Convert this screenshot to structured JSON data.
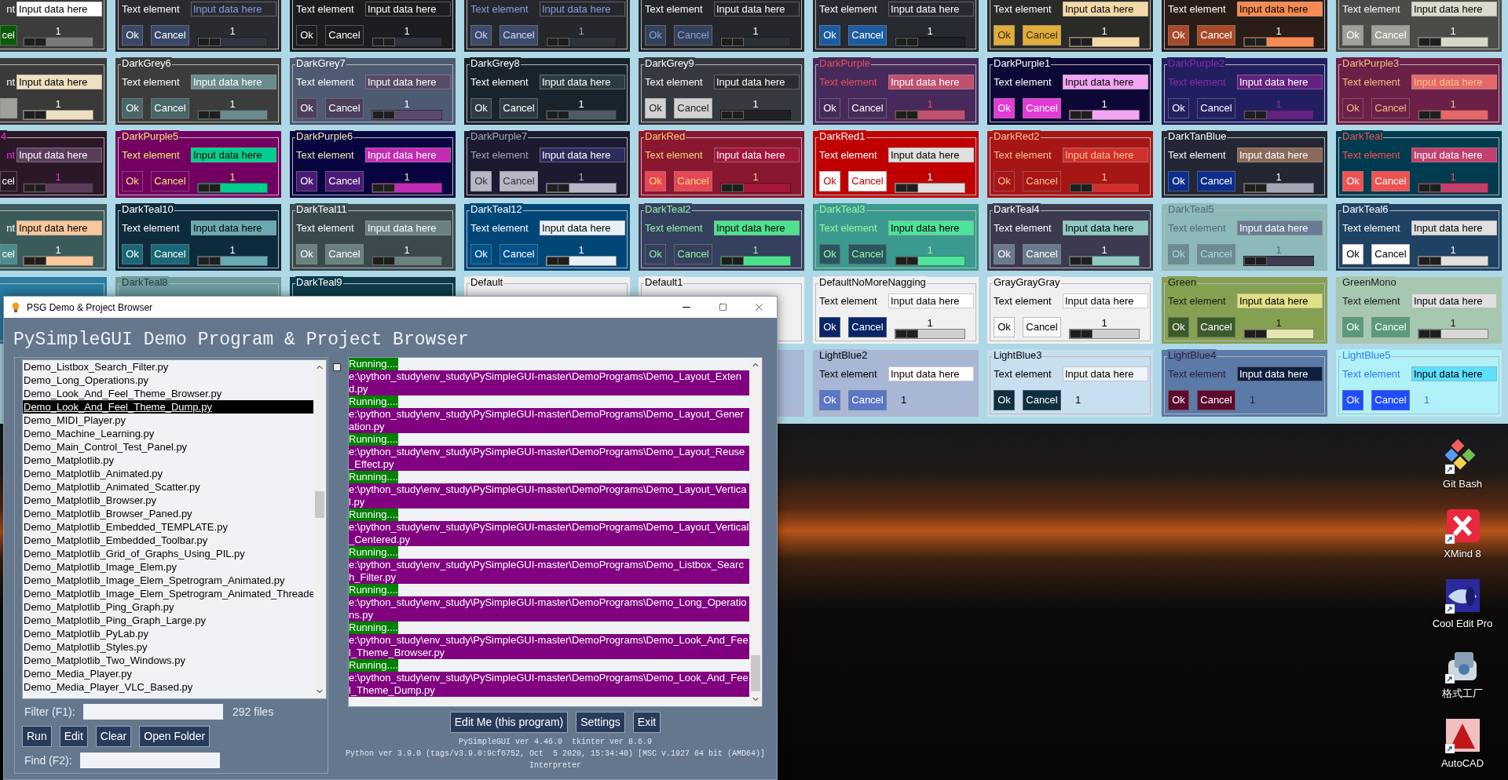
{
  "theme_rows": [
    [
      {
        "kind": "clipped",
        "label": "nt",
        "input": "Input data here",
        "cancel": "cel",
        "value": "1",
        "level": 0,
        "color": "#3c3c3c"
      },
      {
        "kind": "full",
        "label": "Text element",
        "input": "Input data here",
        "ok": "Ok",
        "cancel": "Cancel",
        "value": "1",
        "level": 0,
        "color": "#2a2b30"
      },
      {
        "kind": "full",
        "label": "Text element",
        "input": "Input data here",
        "ok": "Ok",
        "cancel": "Cancel",
        "value": "1",
        "level": 0,
        "color": "#1c1d21"
      },
      {
        "kind": "full",
        "label": "Text element",
        "input": "Input data here",
        "ok": "Ok",
        "cancel": "Cancel",
        "value": "1",
        "level": 0,
        "color": "#25272c"
      },
      {
        "kind": "full",
        "label": "Text element",
        "input": "Input data here",
        "ok": "Ok",
        "cancel": "Cancel",
        "value": "1",
        "level": 0,
        "color": "#24262b"
      },
      {
        "kind": "full",
        "label": "Text element",
        "input": "Input data here",
        "ok": "Ok",
        "cancel": "Cancel",
        "value": "1",
        "level": 0,
        "color": "#272a30"
      },
      {
        "kind": "full",
        "label": "Text element",
        "input": "Input data here",
        "ok": "Ok",
        "cancel": "Cancel",
        "value": "1",
        "level": 0,
        "color": "#2a2a27"
      },
      {
        "kind": "full",
        "label": "Text element",
        "input": "Input data here",
        "ok": "Ok",
        "cancel": "Cancel",
        "value": "1",
        "level": 0,
        "color": "#2a1c17"
      },
      {
        "kind": "full",
        "label": "Text element",
        "input": "Input data here",
        "ok": "Ok",
        "cancel": "Cancel",
        "value": "1",
        "level": 0,
        "color": "#4b4b47"
      }
    ],
    [
      {
        "kind": "clipped",
        "label": "nt",
        "input": "Input data here",
        "value": "1",
        "level": 0,
        "color": "#3a3a3a"
      },
      {
        "kind": "full",
        "title": "DarkGrey6",
        "label": "Text element",
        "input": "Input data here",
        "ok": "Ok",
        "cancel": "Cancel",
        "value": "1",
        "level": 0,
        "color": "#3c3c3c"
      },
      {
        "kind": "full",
        "title": "DarkGrey7",
        "label": "Text element",
        "input": "Input data here",
        "ok": "Ok",
        "cancel": "Cancel",
        "value": "1",
        "level": 0,
        "color": "#4d5a72"
      },
      {
        "kind": "full",
        "title": "DarkGrey8",
        "label": "Text element",
        "input": "Input data here",
        "ok": "Ok",
        "cancel": "Cancel",
        "value": "1",
        "level": 0,
        "color": "#18232c"
      },
      {
        "kind": "full",
        "title": "DarkGrey9",
        "label": "Text element",
        "input": "Input data here",
        "ok": "Ok",
        "cancel": "Cancel",
        "value": "1",
        "level": 0,
        "color": "#36393f"
      },
      {
        "kind": "full",
        "title": "DarkPurple",
        "label": "Text element",
        "input": "Input data here",
        "ok": "Ok",
        "cancel": "Cancel",
        "value": "1",
        "level": 0,
        "color": "#472a5c"
      },
      {
        "kind": "full",
        "title": "DarkPurple1",
        "label": "Text element",
        "input": "Input data here",
        "ok": "Ok",
        "cancel": "Cancel",
        "value": "1",
        "level": 0,
        "color": "#0c0735"
      },
      {
        "kind": "full",
        "title": "DarkPurple2",
        "label": "Text element",
        "input": "Input data here",
        "ok": "Ok",
        "cancel": "Cancel",
        "value": "1",
        "level": 0,
        "color": "#211f62"
      },
      {
        "kind": "full",
        "title": "DarkPurple3",
        "label": "Text element",
        "input": "Input data here",
        "ok": "Ok",
        "cancel": "Cancel",
        "value": "1",
        "level": 0,
        "color": "#6c1f47"
      }
    ],
    [
      {
        "kind": "clipped",
        "title": "4",
        "label": "nt",
        "input": "Input data here",
        "cancel": "cel",
        "value": "1",
        "level": 0,
        "color": "#2a1727"
      },
      {
        "kind": "full",
        "title": "DarkPurple5",
        "label": "Text element",
        "input": "Input data here",
        "ok": "Ok",
        "cancel": "Cancel",
        "value": "1",
        "level": 0,
        "color": "#730061"
      },
      {
        "kind": "full",
        "title": "DarkPurple6",
        "label": "Text element",
        "input": "Input data here",
        "ok": "Ok",
        "cancel": "Cancel",
        "value": "1",
        "level": 0,
        "color": "#080440"
      },
      {
        "kind": "full",
        "title": "DarkPurple7",
        "label": "Text element",
        "input": "Input data here",
        "ok": "Ok",
        "cancel": "Cancel",
        "value": "1",
        "level": 0,
        "color": "#1b1a30"
      },
      {
        "kind": "full",
        "title": "DarkRed",
        "label": "Text element",
        "input": "Input data here",
        "ok": "Ok",
        "cancel": "Cancel",
        "value": "1",
        "level": 0,
        "color": "#8a1730"
      },
      {
        "kind": "full",
        "title": "DarkRed1",
        "label": "Text element",
        "input": "Input data here",
        "ok": "Ok",
        "cancel": "Cancel",
        "value": "1",
        "level": 0,
        "color": "#c00000"
      },
      {
        "kind": "full",
        "title": "DarkRed2",
        "label": "Text element",
        "input": "Input data here",
        "ok": "Ok",
        "cancel": "Cancel",
        "value": "1",
        "level": 0,
        "color": "#a81515"
      },
      {
        "kind": "full",
        "title": "DarkTanBlue",
        "label": "Text element",
        "input": "Input data here",
        "ok": "Ok",
        "cancel": "Cancel",
        "value": "1",
        "level": 0,
        "color": "#232734"
      },
      {
        "kind": "full",
        "title": "DarkTeal",
        "label": "Text element",
        "input": "Input data here",
        "ok": "Ok",
        "cancel": "Cancel",
        "value": "1",
        "level": 0,
        "color": "#003b50"
      }
    ],
    [
      {
        "kind": "clipped",
        "label": "nt",
        "input": "Input data here",
        "cancel": "cel",
        "value": "1",
        "level": 0,
        "color": "#3b5b5b"
      },
      {
        "kind": "full",
        "title": "DarkTeal10",
        "label": "Text element",
        "input": "Input data here",
        "ok": "Ok",
        "cancel": "Cancel",
        "value": "1",
        "level": 0,
        "color": "#0d2b3b"
      },
      {
        "kind": "full",
        "title": "DarkTeal11",
        "label": "Text element",
        "input": "Input data here",
        "ok": "Ok",
        "cancel": "Cancel",
        "value": "1",
        "level": 0,
        "color": "#3a4a4c"
      },
      {
        "kind": "full",
        "title": "DarkTeal12",
        "label": "Text element",
        "input": "Input data here",
        "ok": "Ok",
        "cancel": "Cancel",
        "value": "1",
        "level": 0,
        "color": "#004778"
      },
      {
        "kind": "full",
        "title": "DarkTeal2",
        "label": "Text element",
        "input": "Input data here",
        "ok": "Ok",
        "cancel": "Cancel",
        "value": "1",
        "level": 0,
        "color": "#353f5e"
      },
      {
        "kind": "full",
        "title": "DarkTeal3",
        "label": "Text element",
        "input": "Input data here",
        "ok": "Ok",
        "cancel": "Cancel",
        "value": "1",
        "level": 0,
        "color": "#3b9a8f"
      },
      {
        "kind": "full",
        "title": "DarkTeal4",
        "label": "Text element",
        "input": "Input data here",
        "ok": "Ok",
        "cancel": "Cancel",
        "value": "1",
        "level": 0,
        "color": "#3b3a4e"
      },
      {
        "kind": "full",
        "title": "DarkTeal5",
        "label": "Text element",
        "input": "Input data here",
        "ok": "Ok",
        "cancel": "Cancel",
        "value": "1",
        "level": 0,
        "color": "#8cbab9"
      },
      {
        "kind": "full",
        "title": "DarkTeal6",
        "label": "Text element",
        "input": "Input data here",
        "ok": "Ok",
        "cancel": "Cancel",
        "value": "1",
        "level": 0,
        "color": "#1f4263"
      }
    ],
    [
      {
        "kind": "edge",
        "color": "#2a7ca2"
      },
      {
        "kind": "covered",
        "title": "DarkTeal8",
        "color": "#6e9c9e"
      },
      {
        "kind": "covered",
        "title": "DarkTeal9",
        "color": "#0d3a4a"
      },
      {
        "kind": "covered",
        "title": "Default",
        "color": "#f0f0f0"
      },
      {
        "kind": "covered",
        "title": "Default1",
        "color": "#f0f0f0"
      },
      {
        "kind": "full",
        "title": "DefaultNoMoreNagging",
        "label": "Text element",
        "input": "Input data here",
        "ok": "Ok",
        "cancel": "Cancel",
        "value": "1",
        "level": 0,
        "color": "#f0f0f0"
      },
      {
        "kind": "full",
        "title": "GrayGrayGray",
        "label": "Text element",
        "input": "Input data here",
        "ok": "Ok",
        "cancel": "Cancel",
        "value": "1",
        "level": 0,
        "color": "#f0f0f1"
      },
      {
        "kind": "full",
        "title": "Green",
        "label": "Text element",
        "input": "Input data here",
        "ok": "Ok",
        "cancel": "Cancel",
        "value": "1",
        "level": 0,
        "color": "#86a052"
      },
      {
        "kind": "full",
        "title": "GreenMono",
        "label": "Text element",
        "input": "Input data here",
        "ok": "Ok",
        "cancel": "Cancel",
        "value": "1",
        "level": 0,
        "color": "#a6c8b0"
      }
    ],
    [
      {
        "kind": "covered",
        "color": "#a8b8d8"
      },
      {
        "kind": "short",
        "title": "LightBlue2",
        "label": "Text element",
        "input": "Input data here",
        "ok": "Ok",
        "cancel": "Cancel",
        "value": "1",
        "color": "#a8b7d6"
      },
      {
        "kind": "short",
        "title": "LightBlue3",
        "label": "Text element",
        "input": "Input data here",
        "ok": "Ok",
        "cancel": "Cancel",
        "value": "1",
        "color": "#c8dff0"
      },
      {
        "kind": "short",
        "title": "LightBlue4",
        "label": "Text element",
        "input": "Input data here",
        "ok": "Ok",
        "cancel": "Cancel",
        "value": "1",
        "color": "#5b7aa8"
      },
      {
        "kind": "short",
        "title": "LightBlue5",
        "label": "Text element",
        "input": "Input data here",
        "ok": "Ok",
        "cancel": "Cancel",
        "value": "1",
        "color": "#b0f1f8"
      }
    ]
  ],
  "browser": {
    "title": "PSG Demo & Project Browser",
    "heading": "PySimpleGUI Demo Program & Project Browser",
    "files": [
      {
        "name": "Demo_Listbox_Search_Filter.py",
        "selected": false
      },
      {
        "name": "Demo_Long_Operations.py",
        "selected": false
      },
      {
        "name": "Demo_Look_And_Feel_Theme_Browser.py",
        "selected": false
      },
      {
        "name": "Demo_Look_And_Feel_Theme_Dump.py",
        "selected": true
      },
      {
        "name": "Demo_MIDI_Player.py",
        "selected": false
      },
      {
        "name": "Demo_Machine_Learning.py",
        "selected": false
      },
      {
        "name": "Demo_Main_Control_Test_Panel.py",
        "selected": false
      },
      {
        "name": "Demo_Matplotlib.py",
        "selected": false
      },
      {
        "name": "Demo_Matplotlib_Animated.py",
        "selected": false
      },
      {
        "name": "Demo_Matplotlib_Animated_Scatter.py",
        "selected": false
      },
      {
        "name": "Demo_Matplotlib_Browser.py",
        "selected": false
      },
      {
        "name": "Demo_Matplotlib_Browser_Paned.py",
        "selected": false
      },
      {
        "name": "Demo_Matplotlib_Embedded_TEMPLATE.py",
        "selected": false
      },
      {
        "name": "Demo_Matplotlib_Embedded_Toolbar.py",
        "selected": false
      },
      {
        "name": "Demo_Matplotlib_Grid_of_Graphs_Using_PIL.py",
        "selected": false
      },
      {
        "name": "Demo_Matplotlib_Image_Elem.py",
        "selected": false
      },
      {
        "name": "Demo_Matplotlib_Image_Elem_Spetrogram_Animated.py",
        "selected": false
      },
      {
        "name": "Demo_Matplotlib_Image_Elem_Spetrogram_Animated_Threade",
        "selected": false
      },
      {
        "name": "Demo_Matplotlib_Ping_Graph.py",
        "selected": false
      },
      {
        "name": "Demo_Matplotlib_Ping_Graph_Large.py",
        "selected": false
      },
      {
        "name": "Demo_Matplotlib_PyLab.py",
        "selected": false
      },
      {
        "name": "Demo_Matplotlib_Styles.py",
        "selected": false
      },
      {
        "name": "Demo_Matplotlib_Two_Windows.py",
        "selected": false
      },
      {
        "name": "Demo_Media_Player.py",
        "selected": false
      },
      {
        "name": "Demo_Media_Player_VLC_Based.py",
        "selected": false
      }
    ],
    "filter_label": "Filter (F1):",
    "file_count": "292 files",
    "buttons": [
      "Run",
      "Edit",
      "Clear",
      "Open Folder"
    ],
    "find_label": "Find (F2):",
    "checkbox": {
      "checked": false
    },
    "output": [
      {
        "kind": "status",
        "text": "Running...."
      },
      {
        "kind": "path",
        "text": "e:\\python_study\\env_study\\PySimpleGUI-master\\DemoPrograms\\Demo_Layout_Extend.py"
      },
      {
        "kind": "status",
        "text": "Running...."
      },
      {
        "kind": "path",
        "text": "e:\\python_study\\env_study\\PySimpleGUI-master\\DemoPrograms\\Demo_Layout_Generation.py"
      },
      {
        "kind": "status",
        "text": "Running...."
      },
      {
        "kind": "path",
        "text": "e:\\python_study\\env_study\\PySimpleGUI-master\\DemoPrograms\\Demo_Layout_Reuse_Effect.py"
      },
      {
        "kind": "status",
        "text": "Running...."
      },
      {
        "kind": "path",
        "text": "e:\\python_study\\env_study\\PySimpleGUI-master\\DemoPrograms\\Demo_Layout_Vertical.py"
      },
      {
        "kind": "status",
        "text": "Running...."
      },
      {
        "kind": "path",
        "text": "e:\\python_study\\env_study\\PySimpleGUI-master\\DemoPrograms\\Demo_Layout_Vertical_Centered.py"
      },
      {
        "kind": "status",
        "text": "Running...."
      },
      {
        "kind": "path",
        "text": "e:\\python_study\\env_study\\PySimpleGUI-master\\DemoPrograms\\Demo_Listbox_Search_Filter.py"
      },
      {
        "kind": "status",
        "text": "Running...."
      },
      {
        "kind": "path",
        "text": "e:\\python_study\\env_study\\PySimpleGUI-master\\DemoPrograms\\Demo_Long_Operations.py"
      },
      {
        "kind": "status",
        "text": "Running...."
      },
      {
        "kind": "path",
        "text": "e:\\python_study\\env_study\\PySimpleGUI-master\\DemoPrograms\\Demo_Look_And_Feel_Theme_Browser.py"
      },
      {
        "kind": "status",
        "text": "Running...."
      },
      {
        "kind": "path",
        "text": "e:\\python_study\\env_study\\PySimpleGUI-master\\DemoPrograms\\Demo_Look_And_Feel_Theme_Dump.py"
      }
    ],
    "actions": [
      "Edit Me (this program)",
      "Settings",
      "Exit"
    ],
    "version_lines": [
      "PySimpleGUI ver 4.46.0  tkinter ver 8.6.9",
      "Python ver 3.9.0 (tags/v3.9.0:9cf6752, Oct  5 2020, 15:34:40) [MSC v.1927 64 bit (AMD64)]",
      "Interpreter"
    ]
  },
  "desktop_icons": [
    {
      "kind": "git",
      "label": "Git Bash"
    },
    {
      "kind": "xmind",
      "label": "XMind 8"
    },
    {
      "kind": "cooledit",
      "label": "Cool Edit Pro"
    },
    {
      "kind": "factory",
      "label": "格式工厂"
    },
    {
      "kind": "autocad",
      "label": "AutoCAD"
    }
  ]
}
